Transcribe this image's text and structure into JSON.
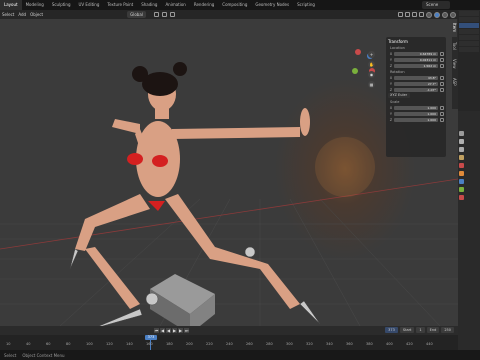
{
  "topbar": {
    "workspaces": [
      "Layout",
      "Modeling",
      "Sculpting",
      "UV Editing",
      "Texture Paint",
      "Shading",
      "Animation",
      "Rendering",
      "Compositing",
      "Geometry Nodes",
      "Scripting"
    ],
    "active_workspace": "Layout",
    "scene_label": "Scene"
  },
  "header": {
    "items": [
      "Select",
      "Add",
      "Object"
    ],
    "orientation": "Global",
    "options_label": "Options"
  },
  "npanel": {
    "title": "Transform",
    "location_label": "Location",
    "location": [
      {
        "axis": "X",
        "value": "0.64789 m"
      },
      {
        "axis": "Y",
        "value": "0.02311 m"
      },
      {
        "axis": "Z",
        "value": "1.562 m"
      }
    ],
    "rotation_label": "Rotation",
    "rotation": [
      {
        "axis": "X",
        "value": "43.8°"
      },
      {
        "axis": "Y",
        "value": "27.7°"
      },
      {
        "axis": "Z",
        "value": "-1.07°"
      }
    ],
    "rotation_mode": "XYZ Euler",
    "scale_label": "Scale",
    "scale": [
      {
        "axis": "X",
        "value": "1.000"
      },
      {
        "axis": "Y",
        "value": "1.000"
      },
      {
        "axis": "Z",
        "value": "1.000"
      }
    ],
    "side_tabs": [
      "Item",
      "Tool",
      "View",
      "ASP"
    ]
  },
  "timeline": {
    "start_label": "Start",
    "start_value": "1",
    "end_label": "End",
    "end_value": "250",
    "current_frame": "373",
    "ticks": [
      "10",
      "40",
      "60",
      "80",
      "100",
      "120",
      "140",
      "160",
      "180",
      "200",
      "220",
      "240",
      "260",
      "280",
      "300",
      "320",
      "340",
      "360",
      "380",
      "400",
      "420",
      "440"
    ]
  },
  "status": {
    "items": [
      "Select",
      "Object Context Menu"
    ]
  },
  "colors": {
    "accent": "#4a7fc4",
    "selected": "#334f7a",
    "axis_x": "#c84a4a",
    "axis_y": "#7ab03c",
    "axis_z": "#4a7fc4"
  }
}
